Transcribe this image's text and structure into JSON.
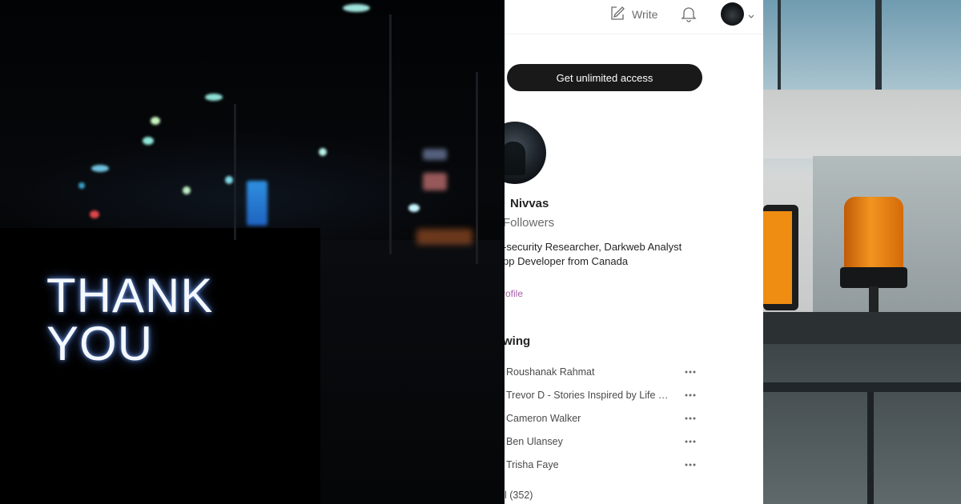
{
  "left_image": {
    "sign_lines": [
      "THANK",
      "YOU"
    ]
  },
  "header": {
    "write_label": "Write",
    "icons": [
      "write-icon",
      "bell-icon",
      "chevron-down-icon"
    ]
  },
  "cta": {
    "label": "Get unlimited access"
  },
  "profile": {
    "name": "Nivvas",
    "followers": "Followers",
    "bio_lines": [
      "-security Researcher, Darkweb Analyst",
      "pp Developer from Canada"
    ],
    "edit_link": "rofile"
  },
  "following": {
    "heading": "wing",
    "items": [
      {
        "name": "Roushanak Rahmat"
      },
      {
        "name": "Trevor D - Stories Inspired by Life & His..."
      },
      {
        "name": "Cameron Walker"
      },
      {
        "name": "Ben Ulansey"
      },
      {
        "name": "Trisha Faye"
      }
    ],
    "see_all": "l (352)"
  },
  "colors": {
    "accent_link": "#a660a6",
    "cta_bg": "#191919",
    "sign_glow": "#5a8cff",
    "beacon_orange": "#e07a10"
  }
}
